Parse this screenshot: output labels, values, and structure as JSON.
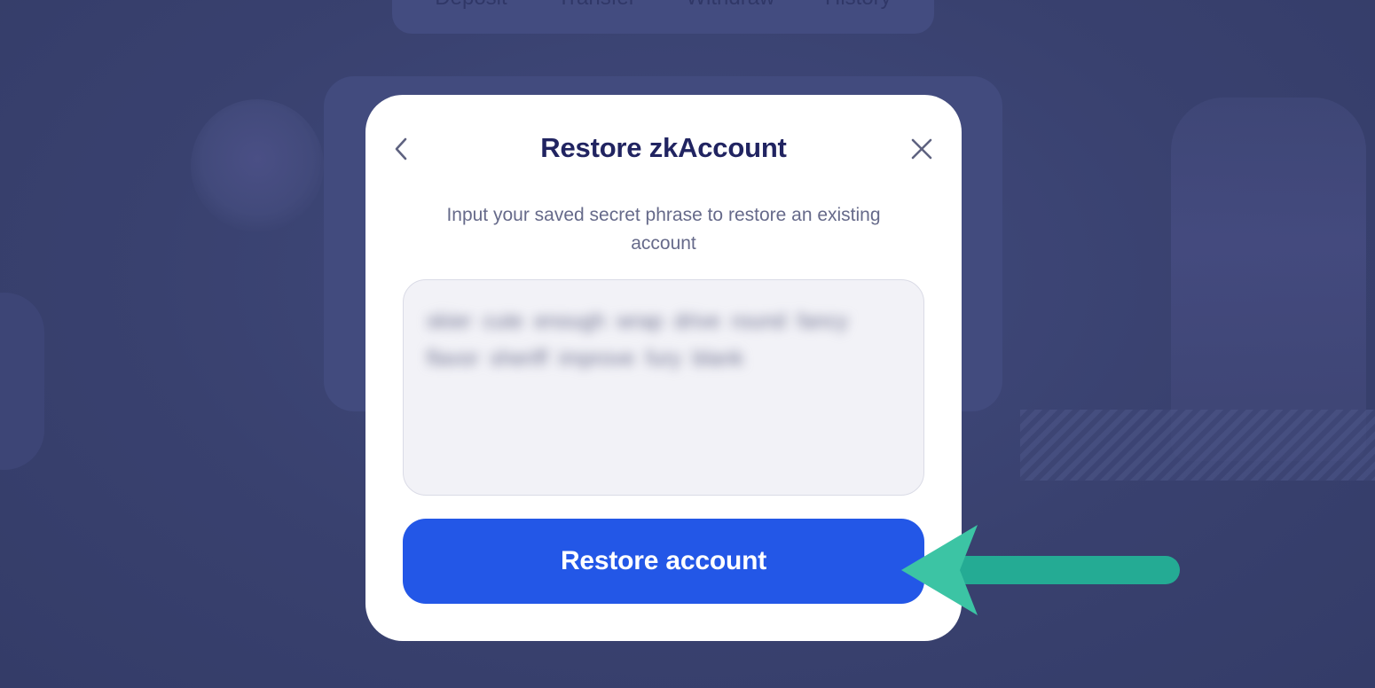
{
  "background": {
    "tabs": [
      "Deposit",
      "Transfer",
      "Withdraw",
      "History"
    ]
  },
  "modal": {
    "title": "Restore zkAccount",
    "description": "Input your saved secret phrase to restore an existing account",
    "phrase_value": "skier cute enough wrap drive round fancy flavor sheriff improve fury blank",
    "button_label": "Restore account",
    "back_icon": "chevron-left-icon",
    "close_icon": "close-icon"
  },
  "colors": {
    "accent": "#2357e7",
    "title": "#212461",
    "annotation": "#2bb59a",
    "overlay": "#3a4272"
  }
}
